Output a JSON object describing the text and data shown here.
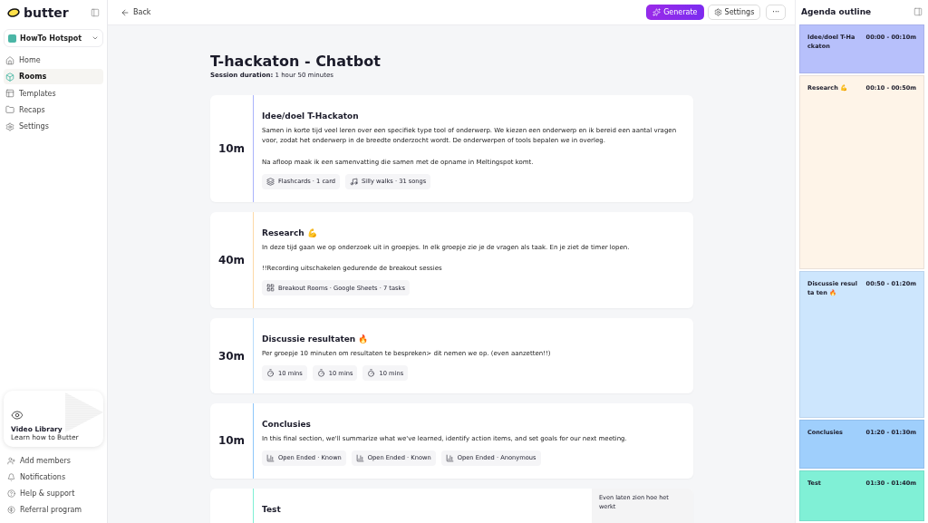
{
  "sidebar": {
    "logo": "butter",
    "workspace": "HowTo Hotspot",
    "nav": [
      {
        "label": "Home",
        "selected": false
      },
      {
        "label": "Rooms",
        "selected": true
      },
      {
        "label": "Templates",
        "selected": false
      },
      {
        "label": "Recaps",
        "selected": false
      },
      {
        "label": "Settings",
        "selected": false
      }
    ],
    "promo": {
      "title": "Video Library",
      "subtitle": "Learn how to Butter"
    },
    "footer": [
      {
        "label": "Add members"
      },
      {
        "label": "Notifications"
      },
      {
        "label": "Help & support"
      },
      {
        "label": "Referral program"
      }
    ]
  },
  "toolbar": {
    "back": "Back",
    "generate": "Generate",
    "settings": "Settings",
    "more": "···"
  },
  "session": {
    "title": "T-hackaton - Chatbot",
    "duration_label": "Session duration:",
    "duration": "1 hour 50 minutes"
  },
  "blocks": [
    {
      "duration": "10m",
      "title": "Idee/doel T-Hackaton",
      "color": "#aab4fb",
      "paragraphs": [
        "Samen in korte tijd veel leren over een specifiek type tool of onderwerp. We kiezen een onderwerp en ik bereid een aantal vragen voor, zodat het onderwerp in de breedte onderzocht wordt. De onderwerpen of tools bepalen we in overleg.",
        "Na afloop maak ik een samenvatting die samen met de opname in Meltingspot komt."
      ],
      "chips": [
        {
          "kind": "cards",
          "label": "Flashcards · 1 card"
        },
        {
          "kind": "music",
          "label": "Silly walks · 31 songs"
        }
      ]
    },
    {
      "duration": "40m",
      "title": "Research 💪",
      "color": "#fcd9a8",
      "paragraphs": [
        "In deze tijd gaan we op onderzoek uit in groepjes. In elk groepje zie je de vragen als taak. En je ziet de timer lopen.",
        "!!Recording uitschakelen gedurende de breakout sessies"
      ],
      "chips": [
        {
          "kind": "grid",
          "label": "Breakout Rooms · Google Sheets · 7 tasks"
        }
      ]
    },
    {
      "duration": "30m",
      "title": "Discussie resultaten 🔥",
      "color": "#b9dcfb",
      "paragraphs": [
        "Per groepje 10 minuten om resultaten te bespreken> dit nemen we op. (even aanzetten!!)"
      ],
      "chips": [
        {
          "kind": "timer",
          "label": "10 mins"
        },
        {
          "kind": "timer",
          "label": "10 mins"
        },
        {
          "kind": "timer",
          "label": "10 mins"
        }
      ]
    },
    {
      "duration": "10m",
      "title": "Conclusies",
      "color": "#8ec7fa",
      "paragraphs": [
        "In this final section, we'll summarize what we've learned, identify action items, and set goals for our next meeting."
      ],
      "chips": [
        {
          "kind": "poll",
          "label": "Open Ended · Known"
        },
        {
          "kind": "poll",
          "label": "Open Ended · Known"
        },
        {
          "kind": "poll",
          "label": "Open Ended · Anonymous"
        }
      ]
    },
    {
      "title": "Test",
      "color": "#7eefd5",
      "note": "Even laten zien hoe het werkt"
    }
  ],
  "outline": {
    "title": "Agenda outline",
    "items": [
      {
        "title": "Idee/doel T-Ha ckaton",
        "time": "00:00 - 00:10m",
        "color": "#b7c0fb"
      },
      {
        "title": "Research 💪",
        "time": "00:10 - 00:50m",
        "color": "#fef4e8"
      },
      {
        "title": "Discussie resulta ten 🔥",
        "time": "00:50 - 01:20m",
        "color": "#cde6fd"
      },
      {
        "title": "Conclusies",
        "time": "01:20 - 01:30m",
        "color": "#9fcffc"
      },
      {
        "title": "Test",
        "time": "01:30 - 01:40m",
        "color": "#80f0d6"
      }
    ]
  }
}
